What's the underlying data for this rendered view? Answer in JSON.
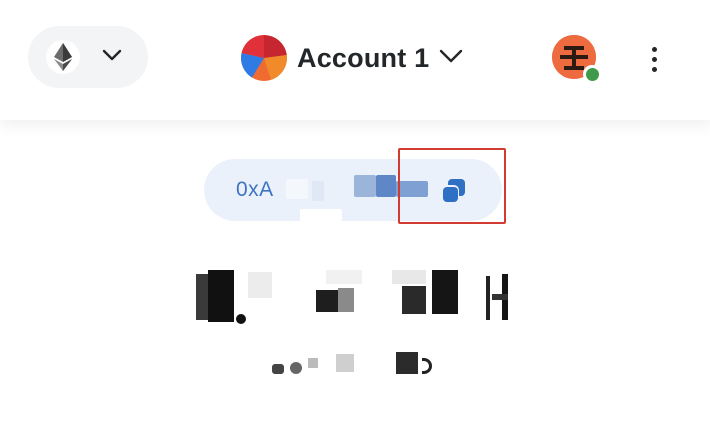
{
  "header": {
    "network_icon": "ethereum-icon",
    "network_chevron": "chevron-down-icon",
    "account_name": "Account 1",
    "account_chevron": "chevron-down-icon",
    "menu_icon": "kebab-menu-icon"
  },
  "address": {
    "visible_prefix": "0xA",
    "copy_icon": "copy-icon"
  },
  "colors": {
    "accent_blue": "#3f74c2",
    "highlight_red": "#d23b32",
    "pill_bg": "#eaf1fa",
    "status_green": "#3f9a4a"
  }
}
